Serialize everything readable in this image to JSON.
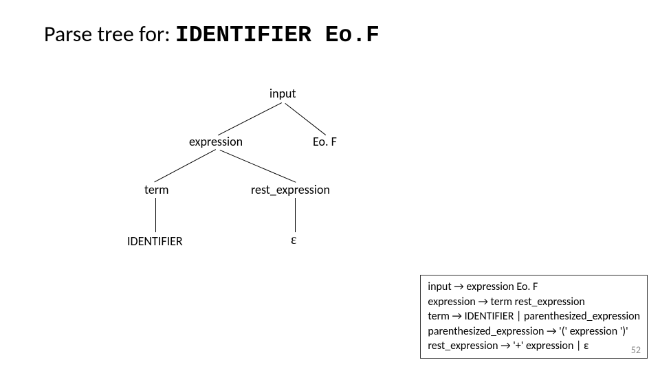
{
  "title": {
    "prefix": "Parse tree for: ",
    "tokens": "IDENTIFIER Eo.F"
  },
  "tree": {
    "input": "input",
    "expression": "expression",
    "eof": "Eo. F",
    "term": "term",
    "rest_expression": "rest_expression",
    "identifier": "IDENTIFIER",
    "epsilon": "ε"
  },
  "grammar": {
    "r1": "input → expression Eo. F",
    "r2": "expression → term rest_expression",
    "r3": "term → IDENTIFIER | parenthesized_expression",
    "r4": "parenthesized_expression → '(' expression ')'",
    "r5": "rest_expression → '+' expression | ε"
  },
  "page_number": "52"
}
